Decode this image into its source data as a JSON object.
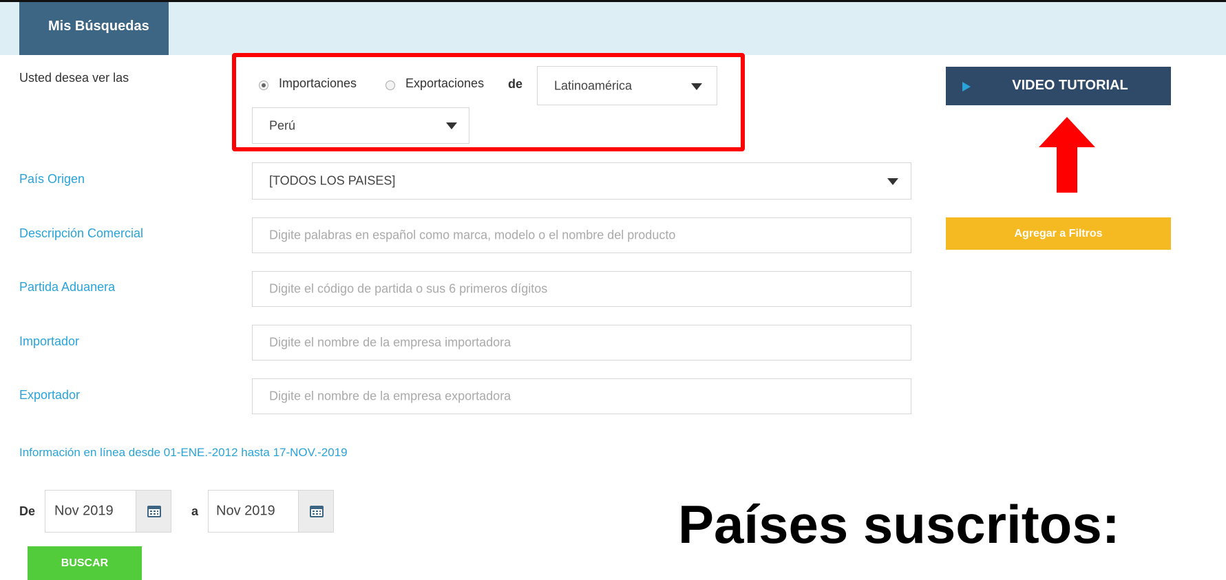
{
  "tab": {
    "label": "Mis Búsquedas"
  },
  "trade": {
    "prompt": "Usted desea ver las",
    "option_import": "Importaciones",
    "option_export": "Exportaciones",
    "selected": "Importaciones",
    "connector": "de",
    "region": "Latinoamérica",
    "country": "Perú"
  },
  "fields": {
    "pais_origen": {
      "label": "País Origen",
      "value": "[TODOS LOS PAISES]"
    },
    "descripcion": {
      "label": "Descripción Comercial",
      "placeholder": "Digite palabras en español como marca, modelo o el nombre del producto"
    },
    "partida": {
      "label": "Partida Aduanera",
      "placeholder": "Digite el código de partida o sus 6 primeros dígitos"
    },
    "importador": {
      "label": "Importador",
      "placeholder": "Digite el nombre de la empresa importadora"
    },
    "exportador": {
      "label": "Exportador",
      "placeholder": "Digite el nombre de la empresa exportadora"
    }
  },
  "info_text": "Información en línea desde 01-ENE.-2012 hasta 17-NOV.-2019",
  "date_range": {
    "from_label": "De",
    "from_value": "Nov 2019",
    "to_label": "a",
    "to_value": "Nov 2019"
  },
  "buttons": {
    "video": "VIDEO TUTORIAL",
    "filtros": "Agregar a Filtros",
    "buscar": "BUSCAR"
  },
  "annotation": {
    "text": "Países suscritos:"
  },
  "colors": {
    "tab": "#3d6584",
    "video": "#2f4a68",
    "filtros": "#f5b921",
    "buscar": "#52cc3b",
    "label": "#29a3d8",
    "highlight": "#ff0000"
  },
  "icons": [
    "play-icon",
    "calendar-icon",
    "caret-down-icon",
    "up-arrow-icon"
  ]
}
